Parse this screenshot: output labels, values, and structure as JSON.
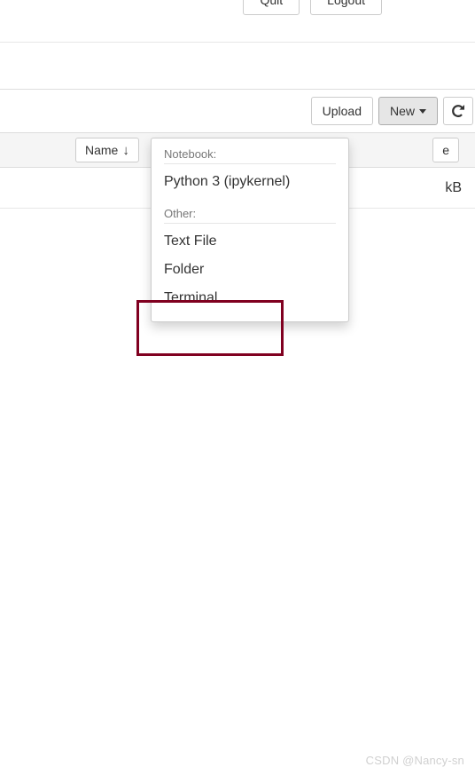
{
  "topbar": {
    "quit": "Quit",
    "logout": "Logout"
  },
  "toolbar": {
    "upload": "Upload",
    "new": "New"
  },
  "columns": {
    "name": "Name",
    "right_suffix": "e"
  },
  "row": {
    "size_suffix": "kB"
  },
  "dropdown": {
    "notebook_header": "Notebook:",
    "python": "Python 3 (ipykernel)",
    "other_header": "Other:",
    "textfile": "Text File",
    "folder": "Folder",
    "terminal": "Terminal"
  },
  "watermark": "CSDN @Nancy-sn"
}
